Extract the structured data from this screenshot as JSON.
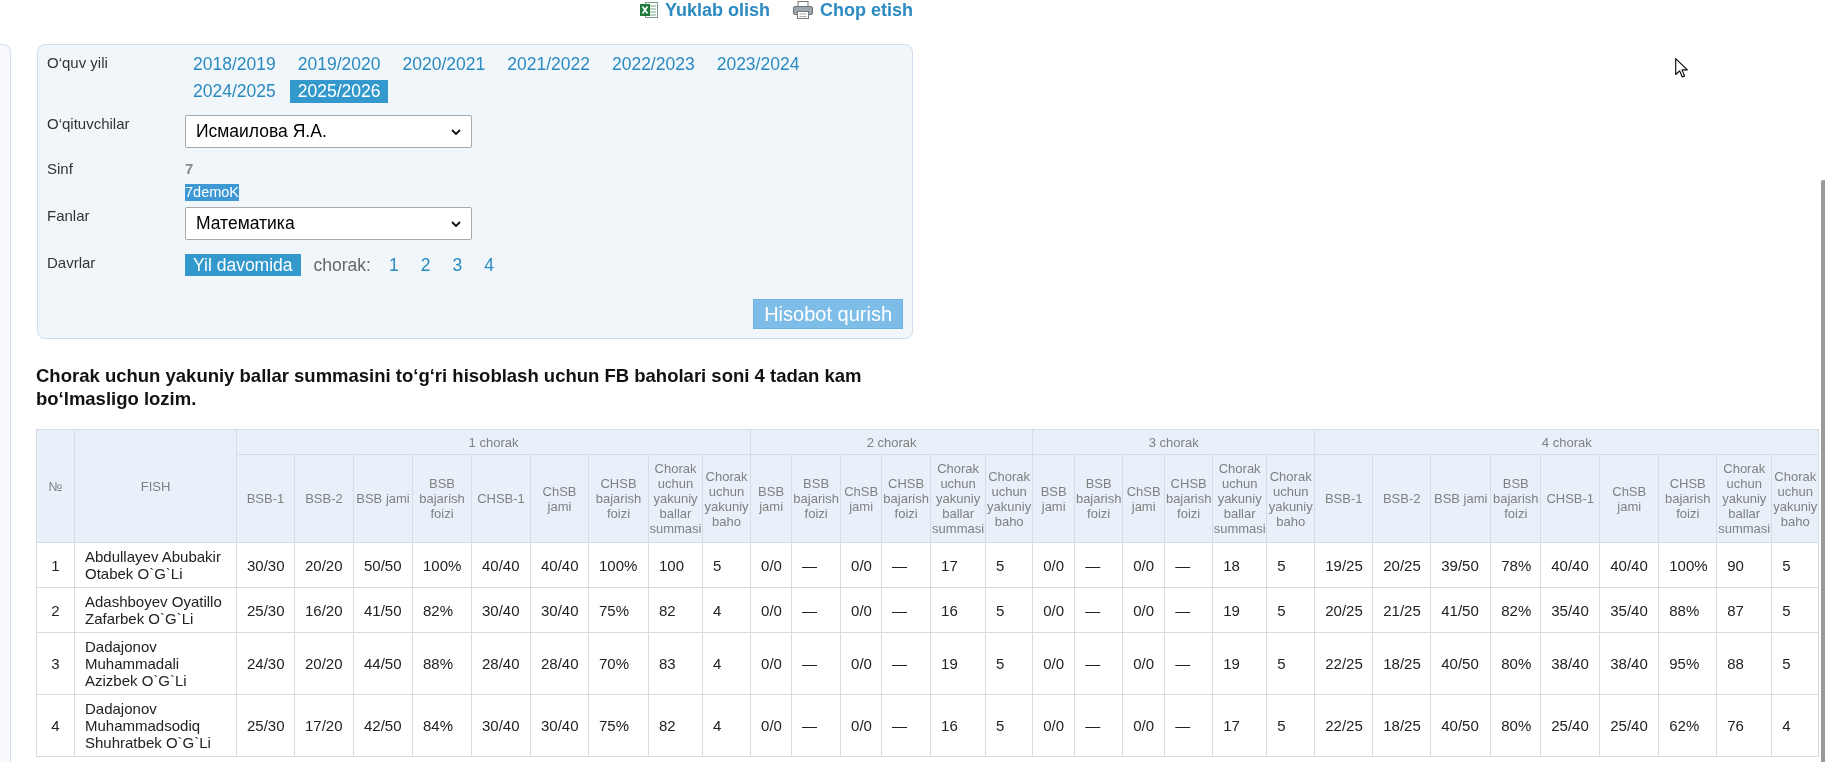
{
  "top_links": [
    {
      "kind": "spreadsheet",
      "label": "Yuklab olish"
    },
    {
      "kind": "printer",
      "label": "Chop etish"
    }
  ],
  "filters": {
    "academic_year": {
      "label": "O‘quv yili",
      "options": [
        {
          "label": "2018/2019",
          "selected": false
        },
        {
          "label": "2019/2020",
          "selected": false
        },
        {
          "label": "2020/2021",
          "selected": false
        },
        {
          "label": "2021/2022",
          "selected": false
        },
        {
          "label": "2022/2023",
          "selected": false
        },
        {
          "label": "2023/2024",
          "selected": false
        },
        {
          "label": "2024/2025",
          "selected": false
        },
        {
          "label": "2025/2026",
          "selected": true
        }
      ]
    },
    "teacher": {
      "label": "O‘qituvchilar",
      "value": "Исмаилова Я.А."
    },
    "class": {
      "label": "Sinf",
      "grade": "7",
      "name": "7demoK",
      "name_highlighted": true
    },
    "subject": {
      "label": "Fanlar",
      "value": "Математика"
    },
    "period": {
      "label": "Davrlar",
      "options": [
        {
          "label": "Yil davomida",
          "selected": true
        }
      ],
      "quarter_label": "chorak:",
      "quarters": [
        {
          "label": "1",
          "selected": false
        },
        {
          "label": "2",
          "selected": false
        },
        {
          "label": "3",
          "selected": false
        },
        {
          "label": "4",
          "selected": false
        }
      ]
    },
    "submit_button": "Hisobot qurish"
  },
  "notice": "Chorak uchun yakuniy ballar summasini to‘g‘ri hisoblash uchun FB baholari soni 4 tadan kam bo‘lmasligo lozim.",
  "table": {
    "columns": [
      {
        "label": "№"
      },
      {
        "label": "FISH"
      }
    ],
    "groups": [
      {
        "label": "1 chorak",
        "columns": [
          "BSB-1",
          "BSB-2",
          "BSB jami",
          "BSB bajarish foizi",
          "CHSB-1",
          "ChSB jami",
          "CHSB bajarish foizi",
          "Chorak uchun yakuniy ballar summasi",
          "Chorak uchun yakuniy baho"
        ]
      },
      {
        "label": "2 chorak",
        "columns": [
          "BSB jami",
          "BSB bajarish foizi",
          "ChSB jami",
          "CHSB bajarish foizi",
          "Chorak uchun yakuniy ballar summasi",
          "Chorak uchun yakuniy baho"
        ]
      },
      {
        "label": "3 chorak",
        "columns": [
          "BSB jami",
          "BSB bajarish foizi",
          "ChSB jami",
          "CHSB bajarish foizi",
          "Chorak uchun yakuniy ballar summasi",
          "Chorak uchun yakuniy baho"
        ]
      },
      {
        "label": "4 chorak",
        "columns": [
          "BSB-1",
          "BSB-2",
          "BSB jami",
          "BSB bajarish foizi",
          "CHSB-1",
          "ChSB jami",
          "CHSB bajarish foizi",
          "Chorak uchun yakuniy ballar summasi",
          "Chorak uchun yakuniy baho"
        ]
      }
    ],
    "rows": [
      {
        "number": "1",
        "name": "Abdullayev Abubakir Otabek O`G`Li",
        "values": [
          "30/30",
          "20/20",
          "50/50",
          "100%",
          "40/40",
          "40/40",
          "100%",
          "100",
          "5",
          "0/0",
          "—",
          "0/0",
          "—",
          "17",
          "5",
          "0/0",
          "—",
          "0/0",
          "—",
          "18",
          "5",
          "19/25",
          "20/25",
          "39/50",
          "78%",
          "40/40",
          "40/40",
          "100%",
          "90",
          "5"
        ]
      },
      {
        "number": "2",
        "name": "Adashboyev Oyatillo Zafarbek O`G`Li",
        "values": [
          "25/30",
          "16/20",
          "41/50",
          "82%",
          "30/40",
          "30/40",
          "75%",
          "82",
          "4",
          "0/0",
          "—",
          "0/0",
          "—",
          "16",
          "5",
          "0/0",
          "—",
          "0/0",
          "—",
          "19",
          "5",
          "20/25",
          "21/25",
          "41/50",
          "82%",
          "35/40",
          "35/40",
          "88%",
          "87",
          "5"
        ]
      },
      {
        "number": "3",
        "name": "Dadajonov Muhammadali Azizbek O`G`Li",
        "values": [
          "24/30",
          "20/20",
          "44/50",
          "88%",
          "28/40",
          "28/40",
          "70%",
          "83",
          "4",
          "0/0",
          "—",
          "0/0",
          "—",
          "19",
          "5",
          "0/0",
          "—",
          "0/0",
          "—",
          "19",
          "5",
          "22/25",
          "18/25",
          "40/50",
          "80%",
          "38/40",
          "38/40",
          "95%",
          "88",
          "5"
        ]
      },
      {
        "number": "4",
        "name": "Dadajonov Muhammadsodiq Shuhratbek O`G`Li",
        "values": [
          "25/30",
          "17/20",
          "42/50",
          "84%",
          "30/40",
          "30/40",
          "75%",
          "82",
          "4",
          "0/0",
          "—",
          "0/0",
          "—",
          "16",
          "5",
          "0/0",
          "—",
          "0/0",
          "—",
          "17",
          "5",
          "22/25",
          "18/25",
          "40/50",
          "80%",
          "25/40",
          "25/40",
          "62%",
          "76",
          "4"
        ]
      }
    ]
  }
}
